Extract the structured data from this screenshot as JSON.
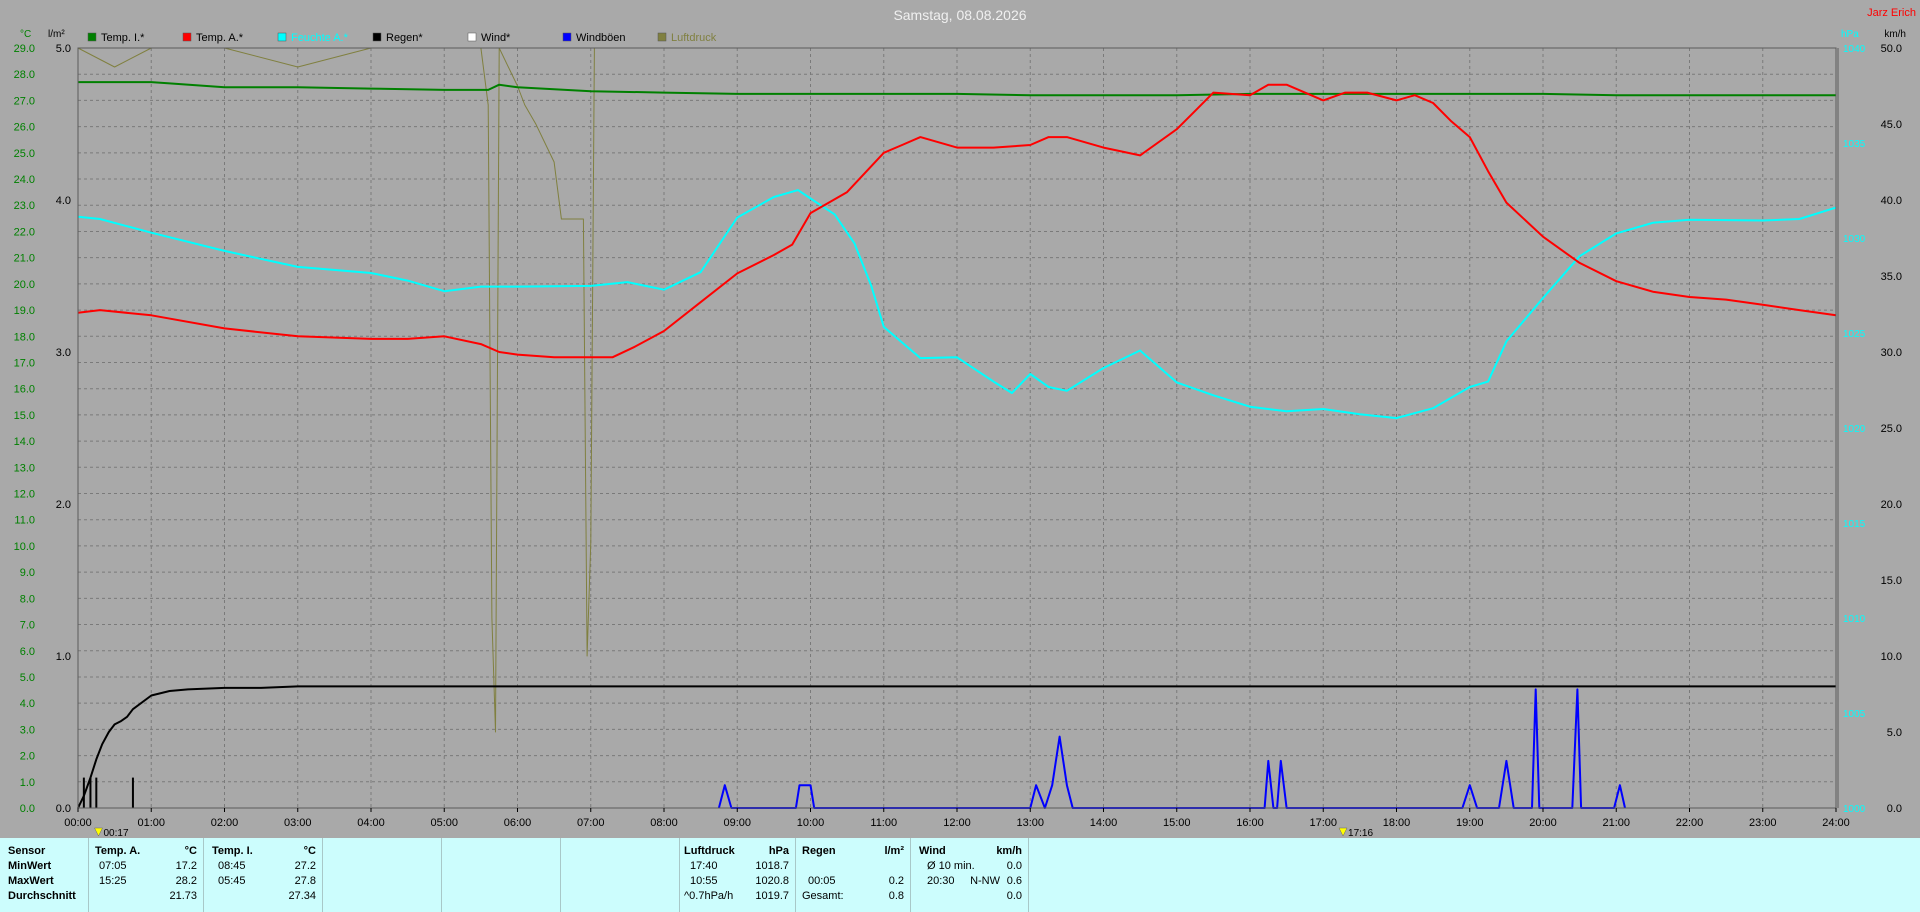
{
  "header": {
    "title": "Samstag, 08.08.2026",
    "author": "Jarz Erich"
  },
  "axes": {
    "temp_unit": "°C",
    "rain_unit": "l/m²",
    "wind_unit_right": "km/h",
    "pressure_unit_right": "hPa",
    "time_markers": [
      "00:17",
      "17:16"
    ]
  },
  "legend": [
    {
      "label": "Temp. I.*",
      "color": "#008000"
    },
    {
      "label": "Temp. A.*",
      "color": "#ff0000"
    },
    {
      "label": "Feuchte A.*",
      "color": "#00ffff"
    },
    {
      "label": "Regen*",
      "color": "#000000"
    },
    {
      "label": "Wind*",
      "color": "#ffffff"
    },
    {
      "label": "Windböen",
      "color": "#0000ff"
    },
    {
      "label": "Luftdruck",
      "color": "#808040"
    }
  ],
  "chart_data": {
    "type": "line",
    "title": "Samstag, 08.08.2026",
    "x_label": "",
    "x_range_hours": [
      0,
      24
    ],
    "x_ticks": [
      "00:00",
      "01:00",
      "02:00",
      "03:00",
      "04:00",
      "05:00",
      "06:00",
      "07:00",
      "08:00",
      "09:00",
      "10:00",
      "11:00",
      "12:00",
      "13:00",
      "14:00",
      "15:00",
      "16:00",
      "17:00",
      "18:00",
      "19:00",
      "20:00",
      "21:00",
      "22:00",
      "23:00",
      "24:00"
    ],
    "temp_axis": {
      "unit": "°C",
      "range": [
        0,
        29
      ],
      "ticks": [
        "0.0",
        "1.0",
        "2.0",
        "3.0",
        "4.0",
        "5.0",
        "6.0",
        "7.0",
        "8.0",
        "9.0",
        "10.0",
        "11.0",
        "12.0",
        "13.0",
        "14.0",
        "15.0",
        "16.0",
        "17.0",
        "18.0",
        "19.0",
        "20.0",
        "21.0",
        "22.0",
        "23.0",
        "24.0",
        "25.0",
        "26.0",
        "27.0",
        "28.0",
        "29.0"
      ]
    },
    "rain_axis": {
      "unit": "l/m²",
      "range": [
        0,
        5
      ],
      "ticks": [
        "0.0",
        "1.0",
        "2.0",
        "3.0",
        "4.0",
        "5.0"
      ]
    },
    "wind_axis": {
      "unit": "km/h",
      "range": [
        0,
        50
      ],
      "ticks": [
        "0.0",
        "5.0",
        "10.0",
        "15.0",
        "20.0",
        "25.0",
        "30.0",
        "35.0",
        "40.0",
        "45.0",
        "50.0"
      ]
    },
    "pressure_axis": {
      "unit": "hPa",
      "range": [
        1000,
        1040
      ],
      "ticks": [
        "1000",
        "1005",
        "1010",
        "1015",
        "1020",
        "1025",
        "1030",
        "1035",
        "1040"
      ]
    },
    "grid": true,
    "series": [
      {
        "name": "Temp. I.*",
        "axis": "temp",
        "color": "#008000",
        "x": [
          0,
          1,
          1.25,
          2,
          3,
          4,
          5,
          5.6,
          5.75,
          6,
          7,
          8,
          9,
          10,
          11,
          12,
          13,
          14,
          15,
          16,
          17,
          18,
          19,
          20,
          21,
          22,
          23,
          24
        ],
        "y": [
          27.7,
          27.7,
          27.65,
          27.5,
          27.5,
          27.45,
          27.4,
          27.4,
          27.6,
          27.5,
          27.35,
          27.3,
          27.25,
          27.25,
          27.25,
          27.25,
          27.2,
          27.2,
          27.2,
          27.25,
          27.25,
          27.25,
          27.25,
          27.25,
          27.2,
          27.2,
          27.2,
          27.2
        ]
      },
      {
        "name": "Temp. A.*",
        "axis": "temp",
        "color": "#ff0000",
        "x": [
          0,
          0.3,
          1,
          2,
          3,
          4,
          4.5,
          5,
          5.5,
          5.75,
          6,
          6.5,
          7,
          7.3,
          7.6,
          8,
          8.5,
          9,
          9.5,
          9.75,
          10,
          10.5,
          11,
          11.25,
          11.5,
          11.75,
          12,
          12.5,
          13,
          13.25,
          13.5,
          14,
          14.5,
          15,
          15.25,
          15.5,
          16,
          16.25,
          16.5,
          17,
          17.3,
          17.6,
          18,
          18.25,
          18.5,
          18.75,
          19,
          19.25,
          19.5,
          20,
          20.5,
          21,
          21.5,
          22,
          22.5,
          23,
          23.5,
          24
        ],
        "y": [
          18.9,
          19.0,
          18.8,
          18.3,
          18.0,
          17.9,
          17.9,
          18.0,
          17.7,
          17.4,
          17.3,
          17.2,
          17.2,
          17.2,
          17.6,
          18.2,
          19.3,
          20.4,
          21.1,
          21.5,
          22.7,
          23.5,
          25.0,
          25.3,
          25.6,
          25.4,
          25.2,
          25.2,
          25.3,
          25.6,
          25.6,
          25.2,
          24.9,
          25.9,
          26.6,
          27.3,
          27.2,
          27.6,
          27.6,
          27.0,
          27.3,
          27.3,
          27.0,
          27.2,
          26.9,
          26.2,
          25.6,
          24.3,
          23.1,
          21.8,
          20.8,
          20.1,
          19.7,
          19.5,
          19.4,
          19.2,
          19.0,
          18.8
        ]
      },
      {
        "name": "Feuchte A.*",
        "axis": "humidity",
        "range": [
          0,
          100
        ],
        "color": "#00ffff",
        "x": [
          0,
          0.3,
          1,
          2,
          3,
          4,
          4.5,
          5,
          5.5,
          6,
          7,
          7.5,
          8,
          8.5,
          9,
          9.5,
          9.83,
          10,
          10.33,
          10.6,
          10.83,
          11,
          11.5,
          12,
          12.5,
          12.75,
          13,
          13.25,
          13.5,
          14,
          14.5,
          15,
          15.5,
          16,
          16.5,
          17,
          17.5,
          18,
          18.5,
          19,
          19.25,
          19.5,
          20,
          20.5,
          21,
          21.5,
          22,
          23,
          23.5,
          24
        ],
        "y": [
          77.8,
          77.5,
          75.7,
          73.3,
          71.2,
          70.4,
          69.4,
          68.0,
          68.6,
          68.6,
          68.7,
          69.2,
          68.2,
          70.5,
          77.7,
          80.4,
          81.3,
          80.2,
          78.1,
          74.3,
          68.7,
          63.3,
          59.2,
          59.3,
          56.1,
          54.6,
          57.1,
          55.4,
          54.9,
          57.9,
          60.2,
          56.0,
          54.3,
          52.8,
          52.2,
          52.5,
          51.8,
          51.3,
          52.6,
          55.4,
          56.1,
          61.4,
          67.1,
          72.6,
          75.6,
          77.0,
          77.4,
          77.3,
          77.5,
          79.0
        ]
      },
      {
        "name": "Regen*",
        "axis": "rain",
        "color": "#000000",
        "x": [
          0,
          0.08,
          0.17,
          0.25,
          0.33,
          0.42,
          0.5,
          0.58,
          0.67,
          0.75,
          1,
          1.25,
          1.5,
          2,
          2.5,
          3,
          4,
          5,
          6,
          7,
          8,
          9,
          10,
          12,
          14,
          16,
          18,
          20,
          22,
          24
        ],
        "y": [
          0,
          0.08,
          0.2,
          0.32,
          0.42,
          0.5,
          0.55,
          0.57,
          0.6,
          0.65,
          0.74,
          0.77,
          0.78,
          0.79,
          0.79,
          0.8,
          0.8,
          0.8,
          0.8,
          0.8,
          0.8,
          0.8,
          0.8,
          0.8,
          0.8,
          0.8,
          0.8,
          0.8,
          0.8,
          0.8
        ]
      },
      {
        "name": "Windböen",
        "axis": "wind",
        "color": "#0000ff",
        "x": [
          8.75,
          8.83,
          8.92,
          9.8,
          9.85,
          10.0,
          10.05,
          13.0,
          13.08,
          13.2,
          13.3,
          13.4,
          13.5,
          13.58,
          16.2,
          16.25,
          16.32,
          16.37,
          16.42,
          16.5,
          18.9,
          19.0,
          19.1,
          19.4,
          19.5,
          19.6,
          19.85,
          19.9,
          19.95,
          20.4,
          20.47,
          20.52,
          20.97,
          21.05,
          21.12
        ],
        "y": [
          0,
          1.5,
          0,
          0,
          1.5,
          1.5,
          0,
          0,
          1.5,
          0,
          1.5,
          4.7,
          1.5,
          0,
          0,
          3.1,
          0,
          0,
          3.1,
          0,
          0,
          1.5,
          0,
          0,
          3.1,
          0,
          0,
          7.8,
          0,
          0,
          7.8,
          0,
          0,
          1.5,
          0
        ]
      },
      {
        "name": "Luftdruck",
        "axis": "pressure",
        "color": "#808040",
        "x": [
          0,
          0.5,
          1,
          2,
          3,
          4,
          5,
          5.5,
          5.6,
          5.65,
          5.7,
          5.75,
          6,
          6.1,
          6.25,
          6.5,
          6.6,
          6.75,
          6.9,
          6.95,
          7.0,
          7.05,
          7.1,
          8,
          9,
          10,
          11,
          12,
          13,
          14,
          15,
          16,
          17,
          18,
          19,
          20,
          21,
          22,
          23,
          24
        ],
        "y": [
          1040,
          1039,
          1040,
          1040,
          1039,
          1040,
          1040,
          1040,
          1037,
          1010,
          1004,
          1040,
          1038,
          1037,
          1036,
          1034,
          1031,
          1031,
          1031,
          1008,
          1014,
          1040,
          1040,
          1040,
          1040,
          1040,
          1040,
          1040,
          1040,
          1040,
          1040,
          1040,
          1040,
          1040,
          1040,
          1040,
          1040,
          1040,
          1040,
          1040
        ]
      }
    ]
  },
  "footer": {
    "sensor": {
      "title": "Sensor",
      "rows": [
        "MinWert",
        "MaxWert",
        "Durchschnitt"
      ]
    },
    "temp_a": {
      "title": "Temp. A.",
      "unit": "°C",
      "min_time": "07:05",
      "min_val": "17.2",
      "max_time": "15:25",
      "max_val": "28.2",
      "avg": "21.73"
    },
    "temp_i": {
      "title": "Temp. I.",
      "unit": "°C",
      "min_time": "08:45",
      "min_val": "27.2",
      "max_time": "05:45",
      "max_val": "27.8",
      "avg": "27.34"
    },
    "pressure": {
      "title": "Luftdruck",
      "unit": "hPa",
      "min_time": "17:40",
      "min_val": "1018.7",
      "max_time": "10:55",
      "max_val": "1020.8",
      "trend": "^0.7hPa/h",
      "avg": "1019.7"
    },
    "rain": {
      "title": "Regen",
      "unit": "l/m²",
      "max_time": "00:05",
      "max_val": "0.2",
      "total_label": "Gesamt:",
      "total": "0.8"
    },
    "wind": {
      "title": "Wind",
      "unit": "km/h",
      "avg_label": "Ø 10 min.",
      "avg_val": "0.0",
      "max_time": "20:30",
      "max_dir": "N-NW",
      "max_val": "0.6",
      "last": "0.0"
    }
  }
}
